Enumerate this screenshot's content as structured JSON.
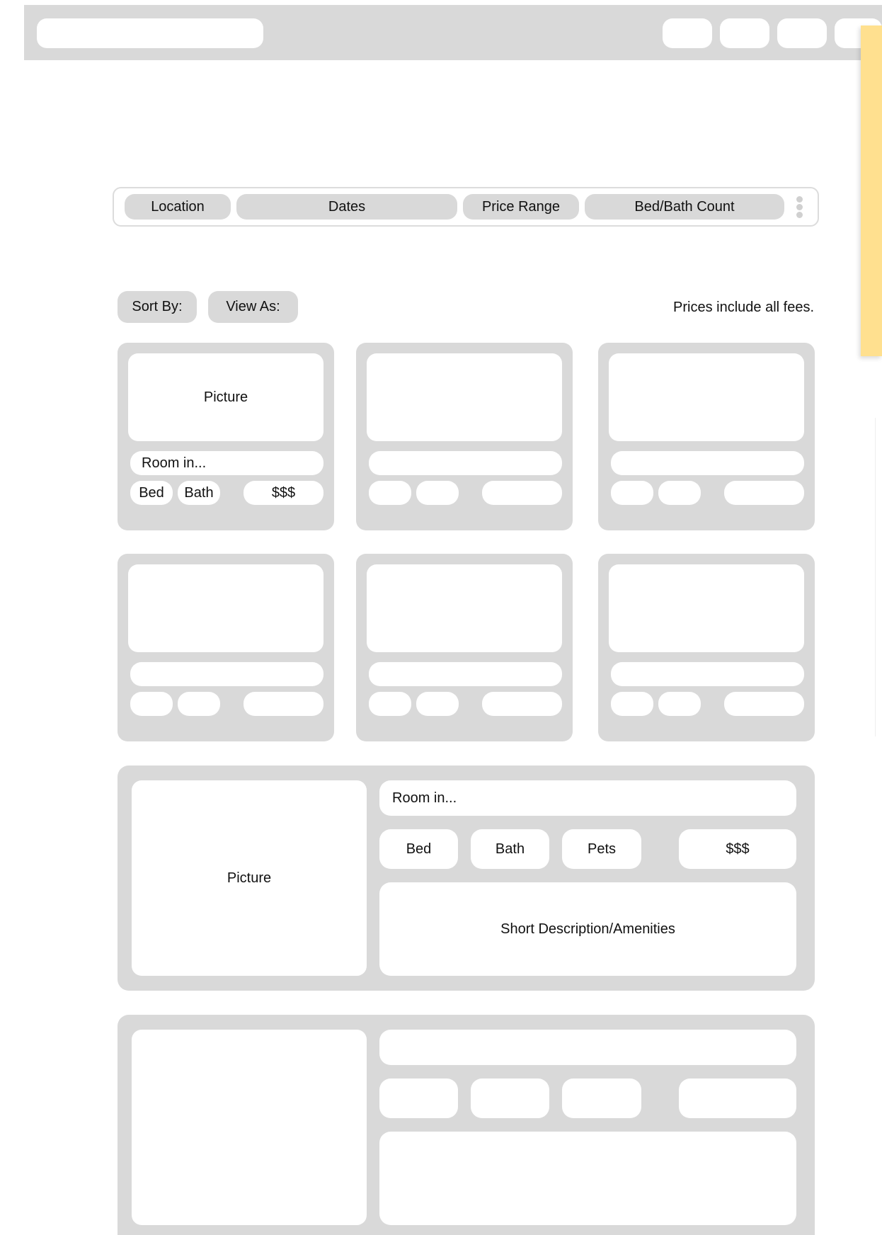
{
  "filters": {
    "location": "Location",
    "dates": "Dates",
    "price_range": "Price Range",
    "bed_bath": "Bed/Bath Count"
  },
  "toolbar": {
    "sort_by": "Sort By:",
    "view_as": "View As:",
    "fees_note": "Prices include all fees."
  },
  "grid_card": {
    "picture": "Picture",
    "room": "Room in...",
    "bed": "Bed",
    "bath": "Bath",
    "price": "$$$"
  },
  "list_card": {
    "picture": "Picture",
    "room": "Room in...",
    "bed": "Bed",
    "bath": "Bath",
    "pets": "Pets",
    "price": "$$$",
    "description": "Short Description/Amenities"
  },
  "colors": {
    "placeholder_grey": "#d9d9d9",
    "sticky_note": "#ffe08f"
  }
}
